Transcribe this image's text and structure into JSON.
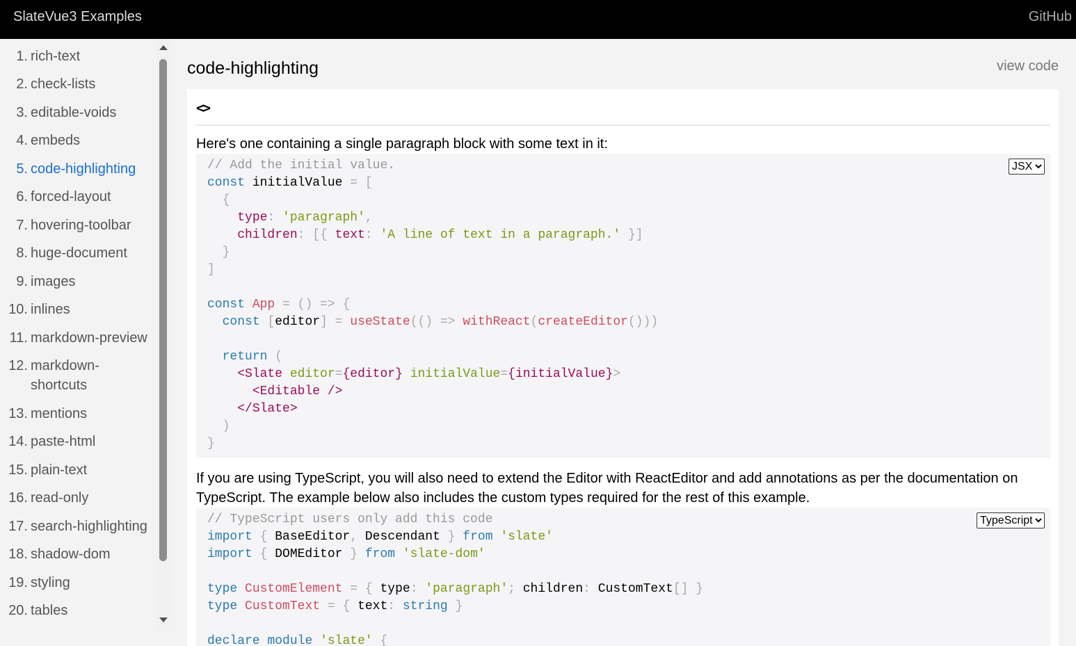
{
  "header": {
    "title": "SlateVue3 Examples",
    "github_label": "GitHub"
  },
  "sidebar": {
    "items": [
      {
        "num": "1.",
        "label": "rich-text"
      },
      {
        "num": "2.",
        "label": "check-lists"
      },
      {
        "num": "3.",
        "label": "editable-voids"
      },
      {
        "num": "4.",
        "label": "embeds"
      },
      {
        "num": "5.",
        "label": "code-highlighting",
        "active": true
      },
      {
        "num": "6.",
        "label": "forced-layout"
      },
      {
        "num": "7.",
        "label": "hovering-toolbar"
      },
      {
        "num": "8.",
        "label": "huge-document"
      },
      {
        "num": "9.",
        "label": "images"
      },
      {
        "num": "10.",
        "label": "inlines"
      },
      {
        "num": "11.",
        "label": "markdown-preview"
      },
      {
        "num": "12.",
        "label": "markdown-shortcuts",
        "label_line1": "markdown-",
        "label_line2": "shortcuts"
      },
      {
        "num": "13.",
        "label": "mentions"
      },
      {
        "num": "14.",
        "label": "paste-html"
      },
      {
        "num": "15.",
        "label": "plain-text"
      },
      {
        "num": "16.",
        "label": "read-only"
      },
      {
        "num": "17.",
        "label": "search-highlighting"
      },
      {
        "num": "18.",
        "label": "shadow-dom"
      },
      {
        "num": "19.",
        "label": "styling"
      },
      {
        "num": "20.",
        "label": "tables"
      }
    ]
  },
  "main": {
    "title": "code-highlighting",
    "view_code_label": "view code",
    "toolbar_button_label": "<>",
    "paragraph1": "Here's one containing a single paragraph block with some text in it:",
    "paragraph2_line1": "If you are using TypeScript, you will also need to extend the Editor with ReactEditor and add annotations as per the documentation on",
    "paragraph2_line2": "TypeScript. The example below also includes the custom types required for the rest of this example.",
    "code1": {
      "language": "JSX",
      "languages": [
        "JSX"
      ],
      "lines": [
        [
          [
            "// Add the initial value.",
            "comment"
          ]
        ],
        [
          [
            "const",
            "keyword"
          ],
          [
            " initialValue ",
            "var"
          ],
          [
            "= [",
            "punct"
          ]
        ],
        [
          [
            "  {",
            "punct"
          ]
        ],
        [
          [
            "    ",
            "var"
          ],
          [
            "type",
            "prop"
          ],
          [
            ": ",
            "punct"
          ],
          [
            "'paragraph'",
            "string"
          ],
          [
            ",",
            "punct"
          ]
        ],
        [
          [
            "    ",
            "var"
          ],
          [
            "children",
            "prop"
          ],
          [
            ": [{ ",
            "punct"
          ],
          [
            "text",
            "prop"
          ],
          [
            ": ",
            "punct"
          ],
          [
            "'A line of text in a paragraph.'",
            "string"
          ],
          [
            " }]",
            "punct"
          ]
        ],
        [
          [
            "  }",
            "punct"
          ]
        ],
        [
          [
            "]",
            "punct"
          ]
        ],
        [
          [
            "",
            "var"
          ]
        ],
        [
          [
            "const",
            "keyword"
          ],
          [
            " ",
            "var"
          ],
          [
            "App",
            "func"
          ],
          [
            " = () => {",
            "punct"
          ]
        ],
        [
          [
            "  ",
            "var"
          ],
          [
            "const",
            "keyword"
          ],
          [
            " [",
            "punct"
          ],
          [
            "editor",
            "var"
          ],
          [
            "] = ",
            "punct"
          ],
          [
            "useState",
            "func"
          ],
          [
            "(() => ",
            "punct"
          ],
          [
            "withReact",
            "func"
          ],
          [
            "(",
            "punct"
          ],
          [
            "createEditor",
            "func"
          ],
          [
            "()))",
            "punct"
          ]
        ],
        [
          [
            "",
            "var"
          ]
        ],
        [
          [
            "  ",
            "var"
          ],
          [
            "return",
            "keyword"
          ],
          [
            " (",
            "punct"
          ]
        ],
        [
          [
            "    ",
            "var"
          ],
          [
            "<Slate",
            "tag"
          ],
          [
            " ",
            "var"
          ],
          [
            "editor",
            "attr"
          ],
          [
            "=",
            "punct"
          ],
          [
            "{editor}",
            "tag"
          ],
          [
            " ",
            "var"
          ],
          [
            "initialValue",
            "attr"
          ],
          [
            "=",
            "punct"
          ],
          [
            "{initialValue}",
            "tag"
          ],
          [
            ">",
            "punct"
          ]
        ],
        [
          [
            "      ",
            "var"
          ],
          [
            "<Editable />",
            "tag"
          ]
        ],
        [
          [
            "    ",
            "var"
          ],
          [
            "</Slate>",
            "tag"
          ]
        ],
        [
          [
            "  )",
            "punct"
          ]
        ],
        [
          [
            "}",
            "punct"
          ]
        ]
      ]
    },
    "code2": {
      "language": "TypeScript",
      "languages": [
        "TypeScript"
      ],
      "lines": [
        [
          [
            "// TypeScript users only add this code",
            "comment"
          ]
        ],
        [
          [
            "import",
            "keyword"
          ],
          [
            " { ",
            "punct"
          ],
          [
            "BaseEditor",
            "var"
          ],
          [
            ", ",
            "punct"
          ],
          [
            "Descendant",
            "var"
          ],
          [
            " } ",
            "punct"
          ],
          [
            "from",
            "keyword"
          ],
          [
            " ",
            "var"
          ],
          [
            "'slate'",
            "string"
          ]
        ],
        [
          [
            "import",
            "keyword"
          ],
          [
            " { ",
            "punct"
          ],
          [
            "DOMEditor",
            "var"
          ],
          [
            " } ",
            "punct"
          ],
          [
            "from",
            "keyword"
          ],
          [
            " ",
            "var"
          ],
          [
            "'slate-dom'",
            "string"
          ]
        ],
        [
          [
            "",
            "var"
          ]
        ],
        [
          [
            "type",
            "keyword"
          ],
          [
            " ",
            "var"
          ],
          [
            "CustomElement",
            "type"
          ],
          [
            " = { ",
            "punct"
          ],
          [
            "type",
            "var"
          ],
          [
            ": ",
            "punct"
          ],
          [
            "'paragraph'",
            "string"
          ],
          [
            "; ",
            "punct"
          ],
          [
            "children",
            "var"
          ],
          [
            ": ",
            "punct"
          ],
          [
            "CustomText",
            "var"
          ],
          [
            "[] }",
            "punct"
          ]
        ],
        [
          [
            "type",
            "keyword"
          ],
          [
            " ",
            "var"
          ],
          [
            "CustomText",
            "type"
          ],
          [
            " = { ",
            "punct"
          ],
          [
            "text",
            "var"
          ],
          [
            ": ",
            "punct"
          ],
          [
            "string",
            "keyword"
          ],
          [
            " }",
            "punct"
          ]
        ],
        [
          [
            "",
            "var"
          ]
        ],
        [
          [
            "declare",
            "keyword"
          ],
          [
            " ",
            "var"
          ],
          [
            "module",
            "keyword"
          ],
          [
            " ",
            "var"
          ],
          [
            "'slate'",
            "string"
          ],
          [
            " {",
            "punct"
          ]
        ]
      ]
    }
  },
  "colors": {
    "topbar": "#000000",
    "sidebar_bg": "#f3f3f3",
    "active_link": "#1a6fd1",
    "code_bg": "#f5f5f7"
  }
}
